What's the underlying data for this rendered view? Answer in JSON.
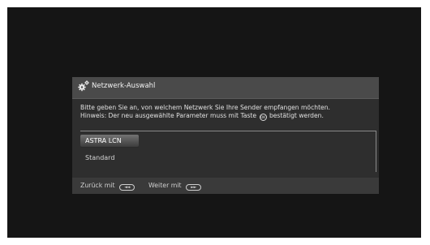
{
  "dialog": {
    "title": "Netzwerk-Auswahl",
    "icon": "gear-icon",
    "info_line1": "Bitte geben Sie an, von welchem Netzwerk Sie Ihre Sender empfangen möchten.",
    "info_line2_before": "Hinweis: Der neu ausgewählte Parameter muss mit Taste",
    "ok_key": "OK",
    "info_line2_after": "bestätigt werden."
  },
  "options": [
    {
      "label": "ASTRA LCN",
      "selected": true
    },
    {
      "label": "Standard",
      "selected": false
    }
  ],
  "footer": {
    "back_label": "Zurück mit",
    "back_key": "◄◄",
    "next_label": "Weiter mit",
    "next_key": "►►"
  },
  "colors": {
    "screen_bg": "#151515",
    "dialog_bg": "#2e2e2e",
    "header_bg": "#4a4a4a",
    "footer_bg": "#3a3a3a",
    "selected_bg": "#5a5a5a"
  }
}
